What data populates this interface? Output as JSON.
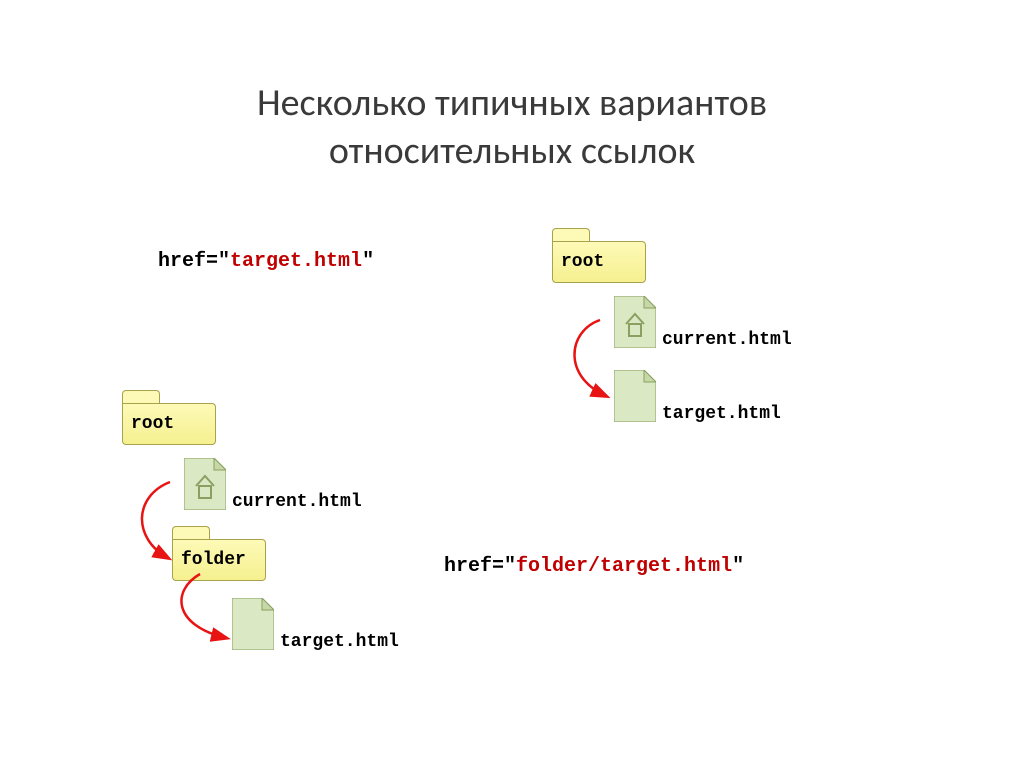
{
  "title_line1": "Несколько типичных вариантов",
  "title_line2": "относительных ссылок",
  "href_label": "href=",
  "quote": "\"",
  "example1": {
    "href_value": "target.html",
    "root_label": "root",
    "current_label": "current.html",
    "target_label": "target.html"
  },
  "example2": {
    "href_value": "folder/target.html",
    "root_label": "root",
    "folder_label": "folder",
    "current_label": "current.html",
    "target_label": "target.html"
  }
}
